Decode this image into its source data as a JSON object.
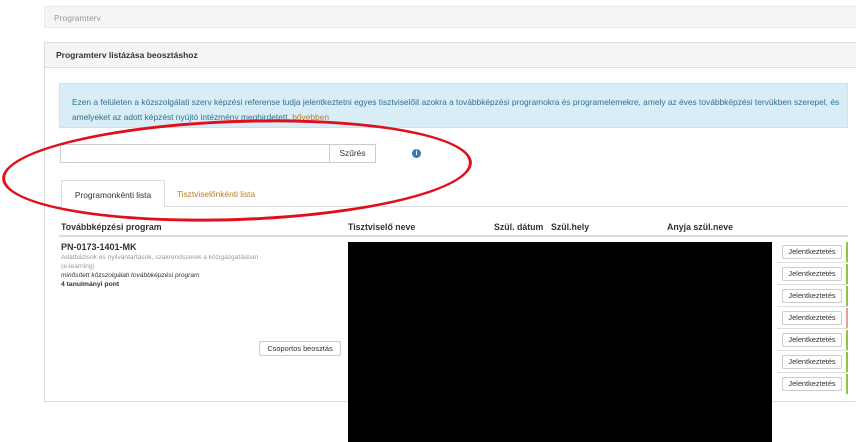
{
  "breadcrumb": "Programterv",
  "panel": {
    "title": "Programterv listázása beosztáshoz"
  },
  "info": {
    "text": "Ezen a felületen a közszolgálati szerv képzési referense tudja jelentkeztetni egyes tisztviselőit azokra a továbbképzési programokra és programelemekre, amely az éves továbbképzési tervükben szerepel, és amelyeket az adott képzést nyújtó intézmény meghirdetett.",
    "more_link": "bővebben"
  },
  "filter": {
    "value": "",
    "button_label": "Szűrés",
    "help_icon": "info-circle-icon",
    "help_glyph": "i"
  },
  "tabs": [
    {
      "label": "Programonkénti lista",
      "active": true
    },
    {
      "label": "Tisztviselőnkénti lista",
      "active": false
    }
  ],
  "table": {
    "columns": [
      "Továbbképzési program",
      "Tisztviselő neve",
      "Szül. dátum",
      "Szül.hely",
      "Anyja szül.neve"
    ],
    "program": {
      "code": "PN-0173-1401-MK",
      "description": "Adatbázisok és nyilvántartások, szakrendszerek a közigazgatásban (e-learning)",
      "type": "minősített közszolgálati továbbképzési program",
      "points": "4 tanulmányi pont"
    },
    "group_button_label": "Csoportos beosztás",
    "rows": [
      {
        "action_label": "Jelentkeztetés",
        "status_color": "#8cc63f"
      },
      {
        "action_label": "Jelentkeztetés",
        "status_color": "#8cc63f"
      },
      {
        "action_label": "Jelentkeztetés",
        "status_color": "#8cc63f"
      },
      {
        "action_label": "Jelentkeztetés",
        "status_color": "#e4a0a0"
      },
      {
        "action_label": "Jelentkeztetés",
        "status_color": "#8cc63f"
      },
      {
        "action_label": "Jelentkeztetés",
        "status_color": "#8cc63f"
      },
      {
        "action_label": "Jelentkeztetés",
        "status_color": "#8cc63f"
      }
    ]
  },
  "colors": {
    "link": "#b27d2c",
    "info_background": "#d9edf7",
    "info_text": "#31708f",
    "annotation": "#e0101a"
  }
}
